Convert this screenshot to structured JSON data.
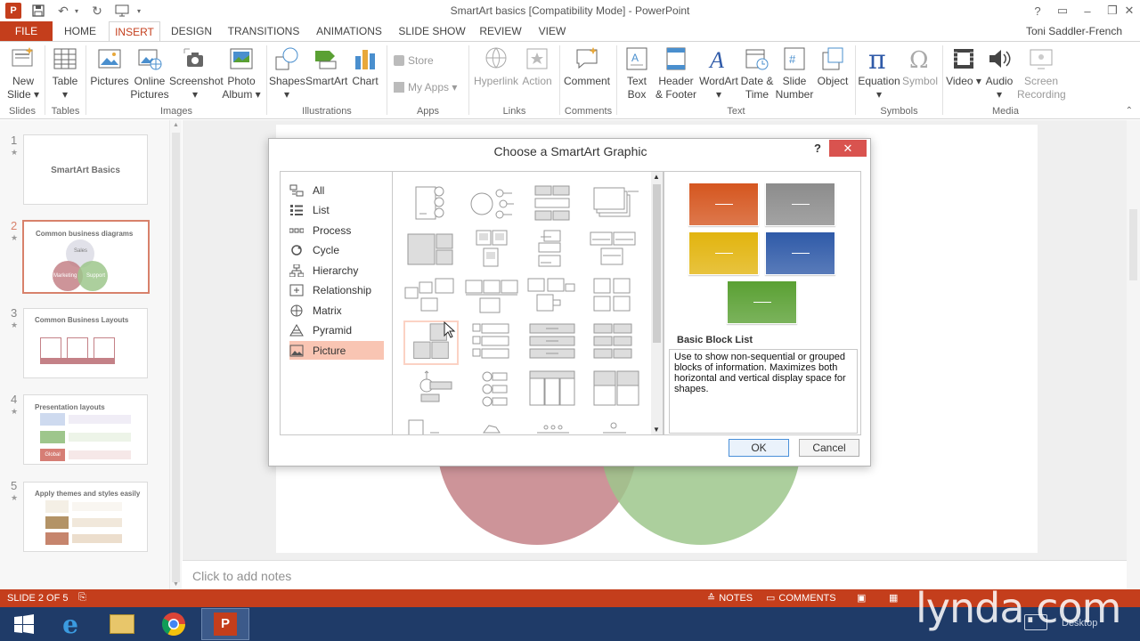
{
  "app": {
    "icon": "P",
    "title": "SmartArt basics [Compatibility Mode] - PowerPoint",
    "user": "Toni Saddler-French",
    "window_controls": [
      "?",
      "▭",
      "–",
      "❐",
      "✕"
    ]
  },
  "tabs": [
    "FILE",
    "HOME",
    "INSERT",
    "DESIGN",
    "TRANSITIONS",
    "ANIMATIONS",
    "SLIDE SHOW",
    "REVIEW",
    "VIEW"
  ],
  "active_tab": "INSERT",
  "ribbon": {
    "groups": [
      "Slides",
      "Tables",
      "Images",
      "Illustrations",
      "Apps",
      "Links",
      "Comments",
      "Text",
      "Symbols",
      "Media"
    ],
    "buttons": {
      "new_slide": "New Slide ▾",
      "table": "Table ▾",
      "pictures": "Pictures",
      "online_pictures": "Online Pictures",
      "screenshot": "Screenshot ▾",
      "photo_album": "Photo Album ▾",
      "shapes": "Shapes ▾",
      "smartart": "SmartArt",
      "chart": "Chart",
      "store": "Store",
      "my_apps": "My Apps ▾",
      "hyperlink": "Hyperlink",
      "action": "Action",
      "comment": "Comment",
      "text_box": "Text Box",
      "header_footer": "Header & Footer",
      "wordart": "WordArt ▾",
      "date_time": "Date & Time",
      "slide_number": "Slide Number",
      "object": "Object",
      "equation": "Equation ▾",
      "symbol": "Symbol",
      "video": "Video ▾",
      "audio": "Audio ▾",
      "screen_recording": "Screen Recording"
    }
  },
  "slides": [
    {
      "num": "1",
      "star": "★",
      "title": "SmartArt Basics"
    },
    {
      "num": "2",
      "star": "★",
      "title": "Common business diagrams",
      "labels": [
        "Sales",
        "Marketing",
        "Support"
      ]
    },
    {
      "num": "3",
      "star": "★",
      "title": "Common Business Layouts"
    },
    {
      "num": "4",
      "star": "★",
      "title": "Presentation layouts",
      "labels": [
        "Global"
      ]
    },
    {
      "num": "5",
      "star": "★",
      "title": "Apply themes and styles easily"
    }
  ],
  "notes_placeholder": "Click to add notes",
  "status": {
    "slide_info": "SLIDE 2 OF 5",
    "notes": "NOTES",
    "comments": "COMMENTS"
  },
  "dialog": {
    "title": "Choose a SmartArt Graphic",
    "help": "?",
    "close": "✕",
    "categories": [
      "All",
      "List",
      "Process",
      "Cycle",
      "Hierarchy",
      "Relationship",
      "Matrix",
      "Pyramid",
      "Picture"
    ],
    "selected_category": "Picture",
    "preview_name": "Basic Block List",
    "preview_description": "Use to show non-sequential or grouped blocks of information. Maximizes both horizontal and vertical display space for shapes.",
    "preview_colors": [
      "#d5561f",
      "#8c8c8c",
      "#e2b40e",
      "#2f5aa8",
      "#5aa033"
    ],
    "ok": "OK",
    "cancel": "Cancel"
  },
  "taskbar": {
    "desktop_label": "Desktop"
  },
  "watermark": "lynda.com"
}
